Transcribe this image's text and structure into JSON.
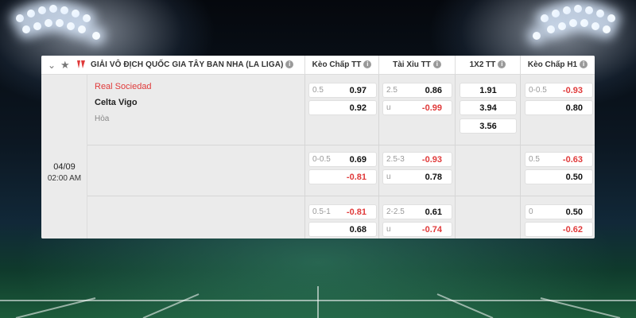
{
  "league": {
    "title": "GIẢI VÔ ĐỊCH QUỐC GIA TÂY BAN NHA (LA LIGA)",
    "info_glyph": "i"
  },
  "columns": [
    {
      "key": "handicap_ft",
      "label": "Kèo Chấp TT"
    },
    {
      "key": "over_under_ft",
      "label": "Tài Xỉu TT"
    },
    {
      "key": "1x2_ft",
      "label": "1X2 TT"
    },
    {
      "key": "handicap_h1",
      "label": "Kèo Chấp H1"
    }
  ],
  "match": {
    "date": "04/09",
    "time": "02:00 AM",
    "home": "Real Sociedad",
    "away": "Celta Vigo",
    "draw": "Hòa"
  },
  "markets": [
    {
      "handicap_ft": [
        {
          "line": "0.5",
          "odd": "0.97",
          "neg": false
        },
        {
          "line": "",
          "odd": "0.92",
          "neg": false
        }
      ],
      "over_under_ft": [
        {
          "line": "2.5",
          "odd": "0.86",
          "neg": false
        },
        {
          "line": "u",
          "odd": "-0.99",
          "neg": true
        }
      ],
      "x12_ft": [
        "1.91",
        "3.94",
        "3.56"
      ],
      "handicap_h1": [
        {
          "line": "0-0.5",
          "odd": "-0.93",
          "neg": true
        },
        {
          "line": "",
          "odd": "0.80",
          "neg": false
        }
      ]
    },
    {
      "handicap_ft": [
        {
          "line": "0-0.5",
          "odd": "0.69",
          "neg": false
        },
        {
          "line": "",
          "odd": "-0.81",
          "neg": true
        }
      ],
      "over_under_ft": [
        {
          "line": "2.5-3",
          "odd": "-0.93",
          "neg": true
        },
        {
          "line": "u",
          "odd": "0.78",
          "neg": false
        }
      ],
      "handicap_h1": [
        {
          "line": "0.5",
          "odd": "-0.63",
          "neg": true
        },
        {
          "line": "",
          "odd": "0.50",
          "neg": false
        }
      ]
    },
    {
      "handicap_ft": [
        {
          "line": "0.5-1",
          "odd": "-0.81",
          "neg": true
        },
        {
          "line": "",
          "odd": "0.68",
          "neg": false
        }
      ],
      "over_under_ft": [
        {
          "line": "2-2.5",
          "odd": "0.61",
          "neg": false
        },
        {
          "line": "u",
          "odd": "-0.74",
          "neg": true
        }
      ],
      "handicap_h1": [
        {
          "line": "0",
          "odd": "0.50",
          "neg": false
        },
        {
          "line": "",
          "odd": "-0.62",
          "neg": true
        }
      ]
    }
  ],
  "icons": {
    "collapse": "chevron-down-icon",
    "favorite": "star-icon",
    "league_logo": "laliga-logo-icon",
    "info": "info-icon"
  },
  "colors": {
    "negative_odd": "#e03a3a",
    "home_team": "#e03a3a",
    "panel_bg": "#ebebeb",
    "cell_bg": "#ffffff"
  }
}
